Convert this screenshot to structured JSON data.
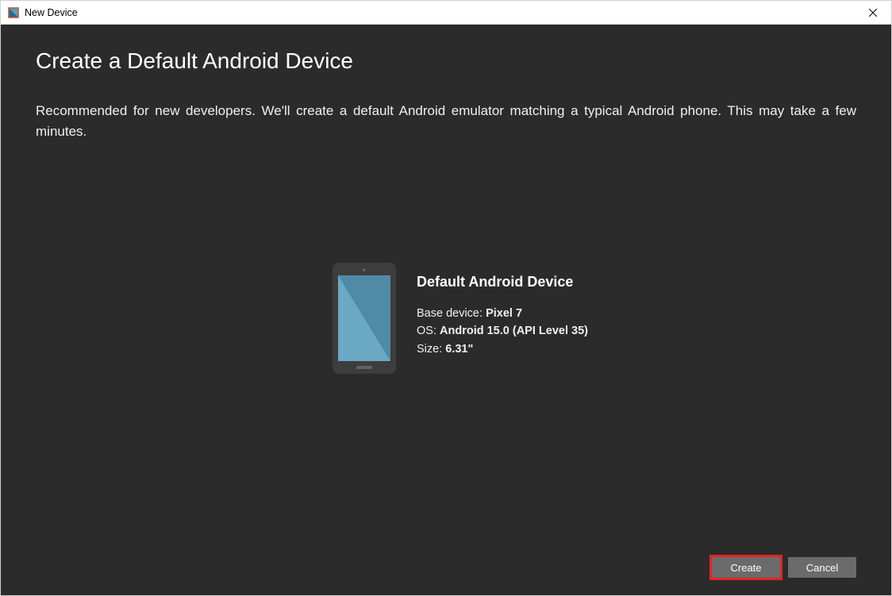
{
  "window": {
    "title": "New Device"
  },
  "page": {
    "heading": "Create a Default Android Device",
    "description": "Recommended for new developers. We'll create a default Android emulator matching a typical Android phone. This may take a few minutes."
  },
  "device": {
    "title": "Default Android Device",
    "base_label": "Base device: ",
    "base_value": "Pixel 7",
    "os_label": "OS: ",
    "os_value": "Android 15.0 (API Level 35)",
    "size_label": "Size: ",
    "size_value": "6.31\""
  },
  "buttons": {
    "create": "Create",
    "cancel": "Cancel"
  }
}
